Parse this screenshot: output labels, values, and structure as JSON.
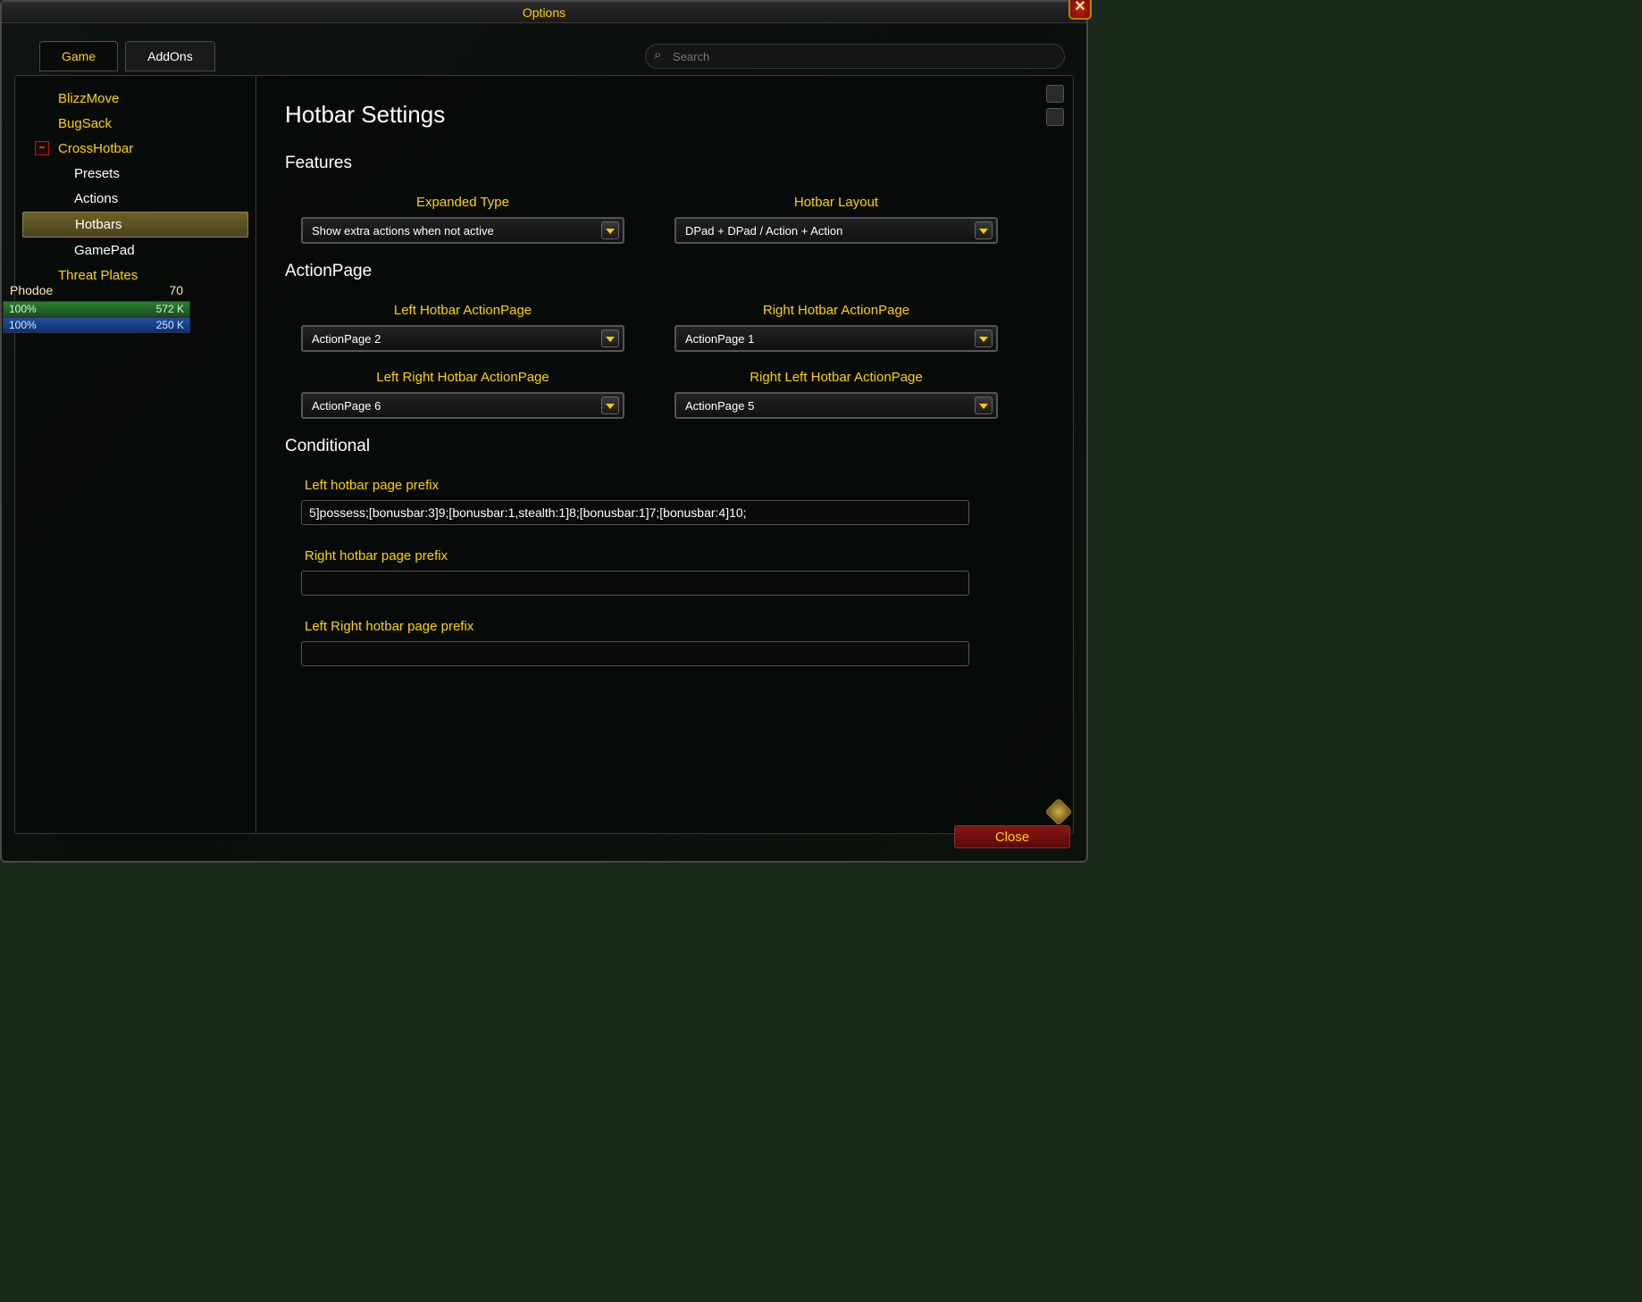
{
  "window": {
    "title": "Options"
  },
  "tabs": {
    "game": "Game",
    "addons": "AddOns"
  },
  "search": {
    "placeholder": "Search"
  },
  "sidebar": {
    "items": [
      "BlizzMove",
      "BugSack",
      "CrossHotbar",
      "Presets",
      "Actions",
      "Hotbars",
      "GamePad",
      "Threat Plates"
    ]
  },
  "bg_portrait": {
    "name": "Phodoe",
    "level": "70",
    "hp_pct": "100%",
    "hp_val": "572 K",
    "mp_pct": "100%",
    "mp_val": "250 K"
  },
  "content": {
    "title": "Hotbar Settings",
    "features": {
      "heading": "Features",
      "expanded_type": {
        "label": "Expanded Type",
        "value": "Show extra actions when not active"
      },
      "hotbar_layout": {
        "label": "Hotbar Layout",
        "value": "DPad + DPad / Action + Action"
      }
    },
    "actionpage": {
      "heading": "ActionPage",
      "left": {
        "label": "Left Hotbar ActionPage",
        "value": "ActionPage 2"
      },
      "right": {
        "label": "Right Hotbar ActionPage",
        "value": "ActionPage 1"
      },
      "left_right": {
        "label": "Left Right Hotbar ActionPage",
        "value": "ActionPage 6"
      },
      "right_left": {
        "label": "Right Left Hotbar ActionPage",
        "value": "ActionPage 5"
      }
    },
    "conditional": {
      "heading": "Conditional",
      "left_prefix": {
        "label": "Left hotbar page prefix",
        "value": "5]possess;[bonusbar:3]9;[bonusbar:1,stealth:1]8;[bonusbar:1]7;[bonusbar:4]10;"
      },
      "right_prefix": {
        "label": "Right hotbar page prefix",
        "value": ""
      },
      "left_right_prefix": {
        "label": "Left Right hotbar page prefix",
        "value": ""
      }
    }
  },
  "footer": {
    "close": "Close"
  }
}
